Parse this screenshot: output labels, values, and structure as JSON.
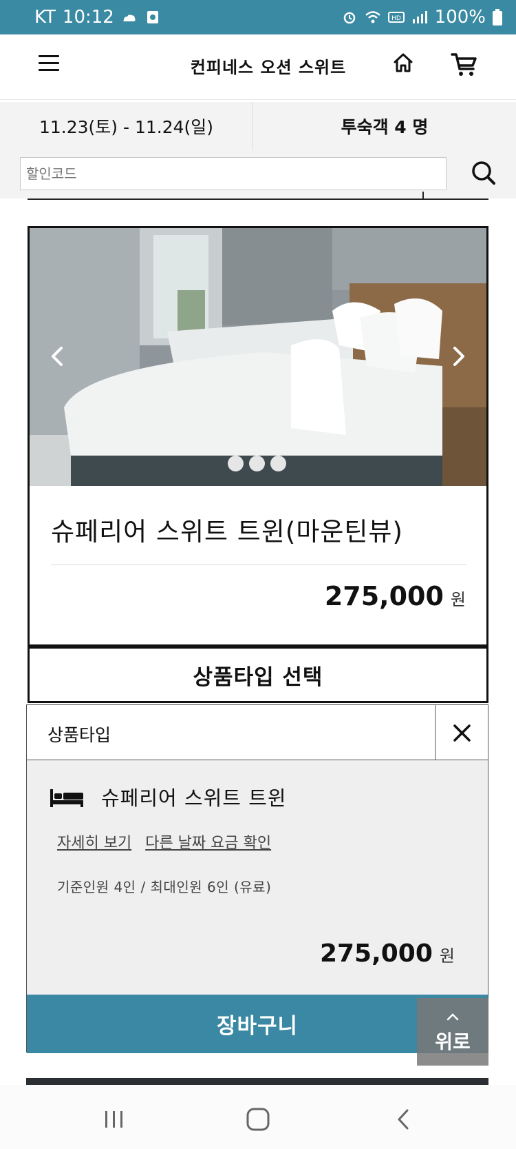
{
  "status_bar": {
    "carrier": "KT",
    "time": "10:12",
    "battery": "100%",
    "icons": [
      "weather-icon",
      "app-notification-icon",
      "alarm-icon",
      "wifi-icon",
      "hd-voice-icon",
      "signal-icon",
      "battery-icon"
    ]
  },
  "header": {
    "title": "컨피네스 오션 스위트",
    "icons": [
      "menu-icon",
      "home-icon",
      "cart-icon"
    ]
  },
  "booking": {
    "dates": "11.23(토) - 11.24(일)",
    "guests": "투숙객 4 명"
  },
  "search": {
    "placeholder": "할인코드",
    "value": ""
  },
  "room": {
    "title": "슈페리어 스위트 트윈(마운틴뷰)",
    "price": "275,000",
    "currency": "원",
    "image_count": 3,
    "active_image": 1
  },
  "select_type": {
    "button_label": "상품타입 선택"
  },
  "type_panel": {
    "header_label": "상품타입",
    "item_name": "슈페리어 스위트 트윈",
    "link_detail": "자세히 보기",
    "link_other_dates": "다른 날짜 요금 확인",
    "capacity": "기준인원 4인 / 최대인원 6인 (유료)",
    "price": "275,000",
    "currency": "원",
    "cart_button": "장바구니"
  },
  "top_button": {
    "label": "위로"
  },
  "colors": {
    "accent": "#3a88a3",
    "status_bar": "#3a8aa3",
    "panel_bg": "#efefef"
  }
}
